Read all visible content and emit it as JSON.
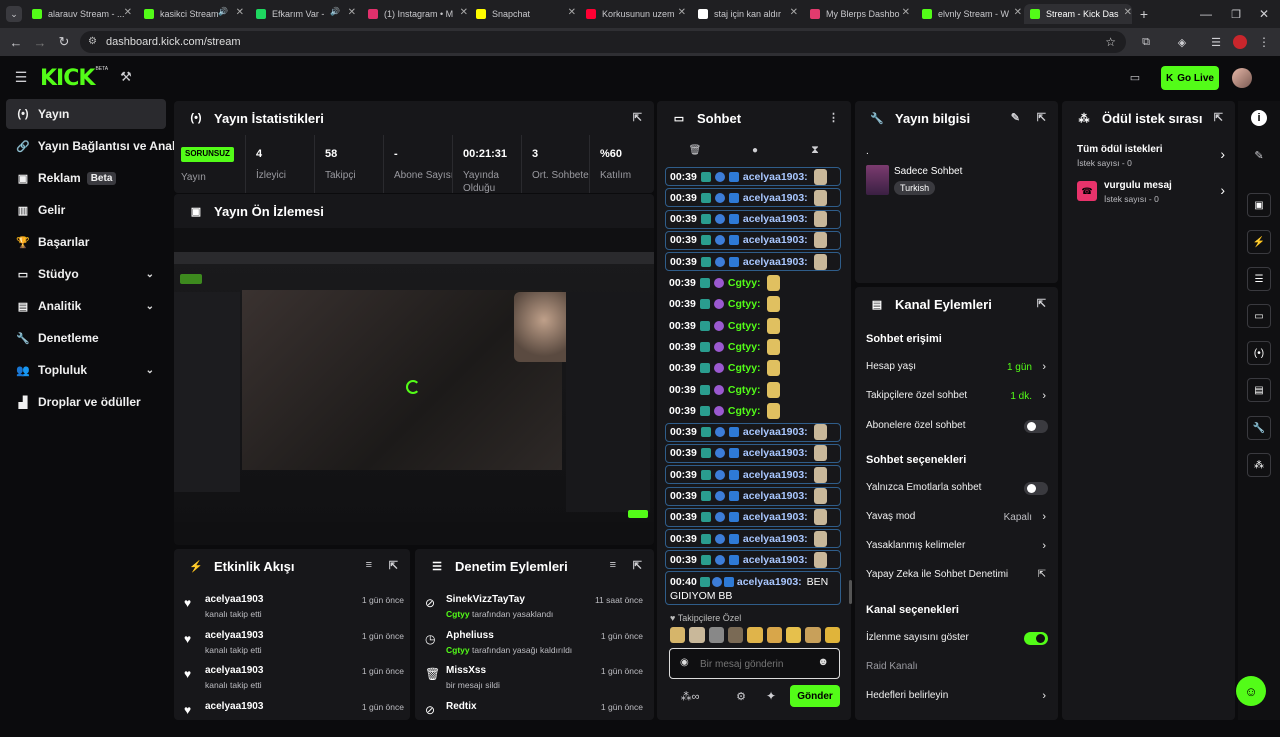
{
  "browser": {
    "tabs": [
      {
        "label": "alarauv Stream - ...",
        "color": "#53fc18",
        "icon": "kick-favicon"
      },
      {
        "label": "kasikci Stream",
        "color": "#53fc18",
        "icon": "kick-favicon",
        "audio": "🔊"
      },
      {
        "label": "Efkarım Var -",
        "color": "#1ed760",
        "icon": "spotify-favicon",
        "audio": "🔊"
      },
      {
        "label": "(1) Instagram • M",
        "color": "#e1306c",
        "icon": "instagram-favicon"
      },
      {
        "label": "Snapchat",
        "color": "#fffc00",
        "icon": "snapchat-favicon"
      },
      {
        "label": "Korkusunun uzem",
        "color": "#ff0033",
        "icon": "youtube-favicon"
      },
      {
        "label": "staj için kan aldır",
        "color": "#ffffff",
        "icon": "google-favicon"
      },
      {
        "label": "My Blerps Dashbo",
        "color": "#e23b6e",
        "icon": "blerp-favicon"
      },
      {
        "label": "elvnly Stream - W",
        "color": "#53fc18",
        "icon": "kick-favicon"
      },
      {
        "label": "Stream - Kick Das",
        "color": "#53fc18",
        "icon": "kick-favicon"
      }
    ],
    "url": "dashboard.kick.com/stream"
  },
  "topnav": {
    "logo": "KICK",
    "logo_sup": "BETA",
    "go_live": "Go Live"
  },
  "sidebar": {
    "items": [
      {
        "label": "Yayın",
        "icon": "broadcast-icon",
        "glyph": "(•)"
      },
      {
        "label": "Yayın Bağlantısı ve Anahtarı",
        "icon": "link-icon",
        "glyph": "🔗"
      },
      {
        "label": "Reklam",
        "icon": "ad-icon",
        "glyph": "▣",
        "badge": "Beta"
      },
      {
        "label": "Gelir",
        "icon": "revenue-icon",
        "glyph": "▥"
      },
      {
        "label": "Başarılar",
        "icon": "trophy-icon",
        "glyph": "🏆"
      },
      {
        "label": "Stüdyo",
        "icon": "studio-icon",
        "glyph": "▭",
        "expand": "⌄"
      },
      {
        "label": "Analitik",
        "icon": "analytics-icon",
        "glyph": "▤",
        "expand": "⌄"
      },
      {
        "label": "Denetleme",
        "icon": "wrench-icon",
        "glyph": "🔧"
      },
      {
        "label": "Topluluk",
        "icon": "community-icon",
        "glyph": "👥",
        "expand": "⌄"
      },
      {
        "label": "Droplar ve ödüller",
        "icon": "drops-icon",
        "glyph": "▟"
      }
    ]
  },
  "stats": {
    "title": "Yayın İstatistikleri",
    "status_badge": "SORUNSUZ",
    "status_label": "Yayın",
    "items": [
      {
        "value": "4",
        "label": "İzleyici"
      },
      {
        "value": "58",
        "label": "Takipçi"
      },
      {
        "value": "-",
        "label": "Abone Sayısı"
      },
      {
        "value": "00:21:31",
        "label": "Yayında Olduğu"
      },
      {
        "value": "3",
        "label": "Ort. Sohbete"
      },
      {
        "value": "%60",
        "label": "Katılım"
      }
    ]
  },
  "preview": {
    "title": "Yayın Ön İzlemesi"
  },
  "chat": {
    "title": "Sohbet",
    "rows": [
      {
        "time": "00:39",
        "user": "acelyaa1903:",
        "color": "#a9c7ff",
        "boxed": true
      },
      {
        "time": "00:39",
        "user": "acelyaa1903:",
        "color": "#a9c7ff",
        "boxed": true
      },
      {
        "time": "00:39",
        "user": "acelyaa1903:",
        "color": "#a9c7ff",
        "boxed": true
      },
      {
        "time": "00:39",
        "user": "acelyaa1903:",
        "color": "#a9c7ff",
        "boxed": true
      },
      {
        "time": "00:39",
        "user": "acelyaa1903:",
        "color": "#a9c7ff",
        "boxed": true
      },
      {
        "time": "00:39",
        "user": "Cgtyy:",
        "color": "#53fc18",
        "boxed": false
      },
      {
        "time": "00:39",
        "user": "Cgtyy:",
        "color": "#53fc18",
        "boxed": false
      },
      {
        "time": "00:39",
        "user": "Cgtyy:",
        "color": "#53fc18",
        "boxed": false
      },
      {
        "time": "00:39",
        "user": "Cgtyy:",
        "color": "#53fc18",
        "boxed": false
      },
      {
        "time": "00:39",
        "user": "Cgtyy:",
        "color": "#53fc18",
        "boxed": false
      },
      {
        "time": "00:39",
        "user": "Cgtyy:",
        "color": "#53fc18",
        "boxed": false
      },
      {
        "time": "00:39",
        "user": "Cgtyy:",
        "color": "#53fc18",
        "boxed": false
      },
      {
        "time": "00:39",
        "user": "acelyaa1903:",
        "color": "#a9c7ff",
        "boxed": true
      },
      {
        "time": "00:39",
        "user": "acelyaa1903:",
        "color": "#a9c7ff",
        "boxed": true
      },
      {
        "time": "00:39",
        "user": "acelyaa1903:",
        "color": "#a9c7ff",
        "boxed": true
      },
      {
        "time": "00:39",
        "user": "acelyaa1903:",
        "color": "#a9c7ff",
        "boxed": true
      },
      {
        "time": "00:39",
        "user": "acelyaa1903:",
        "color": "#a9c7ff",
        "boxed": true
      },
      {
        "time": "00:39",
        "user": "acelyaa1903:",
        "color": "#a9c7ff",
        "boxed": true
      },
      {
        "time": "00:39",
        "user": "acelyaa1903:",
        "color": "#a9c7ff",
        "boxed": true
      }
    ],
    "last": {
      "time": "00:40",
      "user": "acelyaa1903:",
      "text": "BEN GIDIYOM BB"
    },
    "follower_only": "Takipçilere Özel",
    "input_placeholder": "Bir mesaj gönderin",
    "send": "Gönder"
  },
  "events": {
    "title": "Etkinlik Akışı",
    "rows": [
      {
        "name": "acelyaa1903",
        "sub": "kanalı takip etti",
        "time": "1 gün önce"
      },
      {
        "name": "acelyaa1903",
        "sub": "kanalı takip etti",
        "time": "1 gün önce"
      },
      {
        "name": "acelyaa1903",
        "sub": "kanalı takip etti",
        "time": "1 gün önce"
      },
      {
        "name": "acelyaa1903",
        "sub": "",
        "time": "1 gün önce"
      }
    ]
  },
  "moderation": {
    "title": "Denetim Eylemleri",
    "rows": [
      {
        "name": "SinekVizzTayTay",
        "by": "Cgtyy",
        "sub": "tarafından yasaklandı",
        "time": "11 saat önce",
        "icon": "ban-icon",
        "glyph": "⊘"
      },
      {
        "name": "Apheliuss",
        "by": "Cgtyy",
        "sub": "tarafından yasağı kaldırıldı",
        "time": "1 gün önce",
        "icon": "clock-icon",
        "glyph": "◷"
      },
      {
        "name": "MissXss",
        "by": "",
        "sub": "bir mesajı sildi",
        "time": "1 gün önce",
        "icon": "trash-icon",
        "glyph": "🗑"
      },
      {
        "name": "Redtix",
        "by": "",
        "sub": "",
        "time": "1 gün önce",
        "icon": "ban-icon",
        "glyph": "⊘"
      }
    ]
  },
  "stream_info": {
    "title": "Yayın bilgisi",
    "dot": ".",
    "category": "Sadece Sohbet",
    "tag": "Turkish"
  },
  "channel_actions": {
    "title": "Kanal Eylemleri",
    "sec_access": "Sohbet erişimi",
    "account_age": "Hesap yaşı",
    "account_age_val": "1 gün",
    "followers_only": "Takipçilere özel sohbet",
    "followers_only_val": "1 dk.",
    "subs_only": "Abonelere özel sohbet",
    "sec_options": "Sohbet seçenekleri",
    "emotes_only": "Yalnızca Emotlarla sohbet",
    "slow_mode": "Yavaş mod",
    "slow_mode_val": "Kapalı",
    "banned_words": "Yasaklanmış kelimeler",
    "ai_mod": "Yapay Zeka ile Sohbet Denetimi",
    "sec_channel": "Kanal seçenekleri",
    "show_viewers": "İzlenme sayısını göster",
    "raid": "Raid Kanalı",
    "goals": "Hedefleri belirleyin"
  },
  "rewards": {
    "title": "Ödül istek sırası",
    "all": "Tüm ödül istekleri",
    "all_count": "İstek sayısı - 0",
    "highlight": "vurgulu mesaj",
    "highlight_count": "İstek sayısı - 0"
  }
}
